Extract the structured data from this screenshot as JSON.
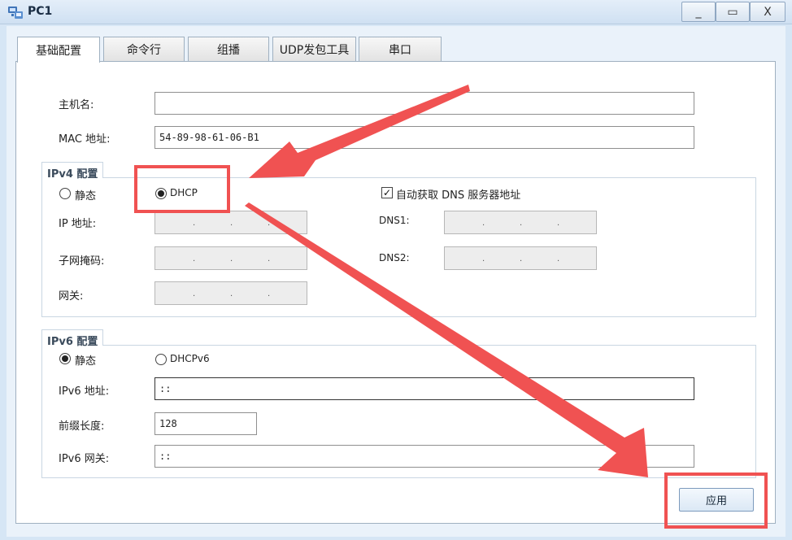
{
  "window": {
    "title": "PC1",
    "minimize_label": "_",
    "maximize_label": "▭",
    "close_label": "X"
  },
  "tabs": [
    {
      "label": "基础配置",
      "active": true
    },
    {
      "label": "命令行",
      "active": false
    },
    {
      "label": "组播",
      "active": false
    },
    {
      "label": "UDP发包工具",
      "active": false
    },
    {
      "label": "串口",
      "active": false
    }
  ],
  "basic": {
    "hostname_label": "主机名:",
    "hostname_value": "",
    "mac_label": "MAC 地址:",
    "mac_value": "54-89-98-61-06-B1"
  },
  "ipv4": {
    "title": "IPv4 配置",
    "static_label": "静态",
    "dhcp_label": "DHCP",
    "selected": "DHCP",
    "auto_dns_label": "自动获取 DNS 服务器地址",
    "auto_dns_checked": true,
    "ip_label": "IP 地址:",
    "mask_label": "子网掩码:",
    "gateway_label": "网关:",
    "dns1_label": "DNS1:",
    "dns2_label": "DNS2:"
  },
  "ipv6": {
    "title": "IPv6 配置",
    "static_label": "静态",
    "dhcpv6_label": "DHCPv6",
    "selected": "静态",
    "ip_label": "IPv6 地址:",
    "ip_value": "::",
    "prefix_label": "前缀长度:",
    "prefix_value": "128",
    "gateway_label": "IPv6 网关:",
    "gateway_value": "::"
  },
  "apply_label": "应用",
  "annotation_color": "#f05252"
}
